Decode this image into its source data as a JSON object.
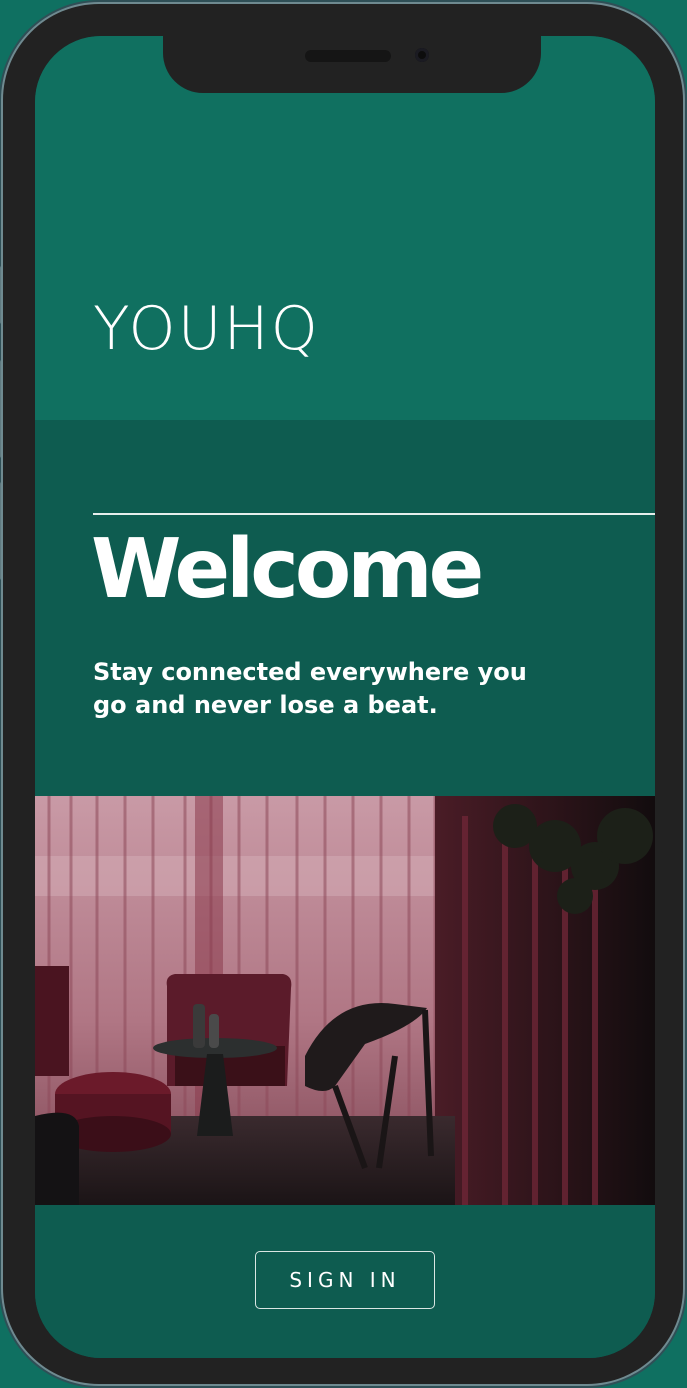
{
  "app": {
    "logo_text": "YOUHQ"
  },
  "welcome": {
    "title": "Welcome",
    "tagline": "Stay connected everywhere you go and never lose a beat."
  },
  "actions": {
    "sign_in_label": "SIGN IN"
  },
  "colors": {
    "page_background": "#0f7061",
    "top_section": "#107060",
    "welcome_section": "#0e5c50",
    "device_frame": "#222222",
    "text": "#ffffff"
  },
  "photo": {
    "subject": "lounge interior with red sheer curtains, chairs and round table"
  }
}
